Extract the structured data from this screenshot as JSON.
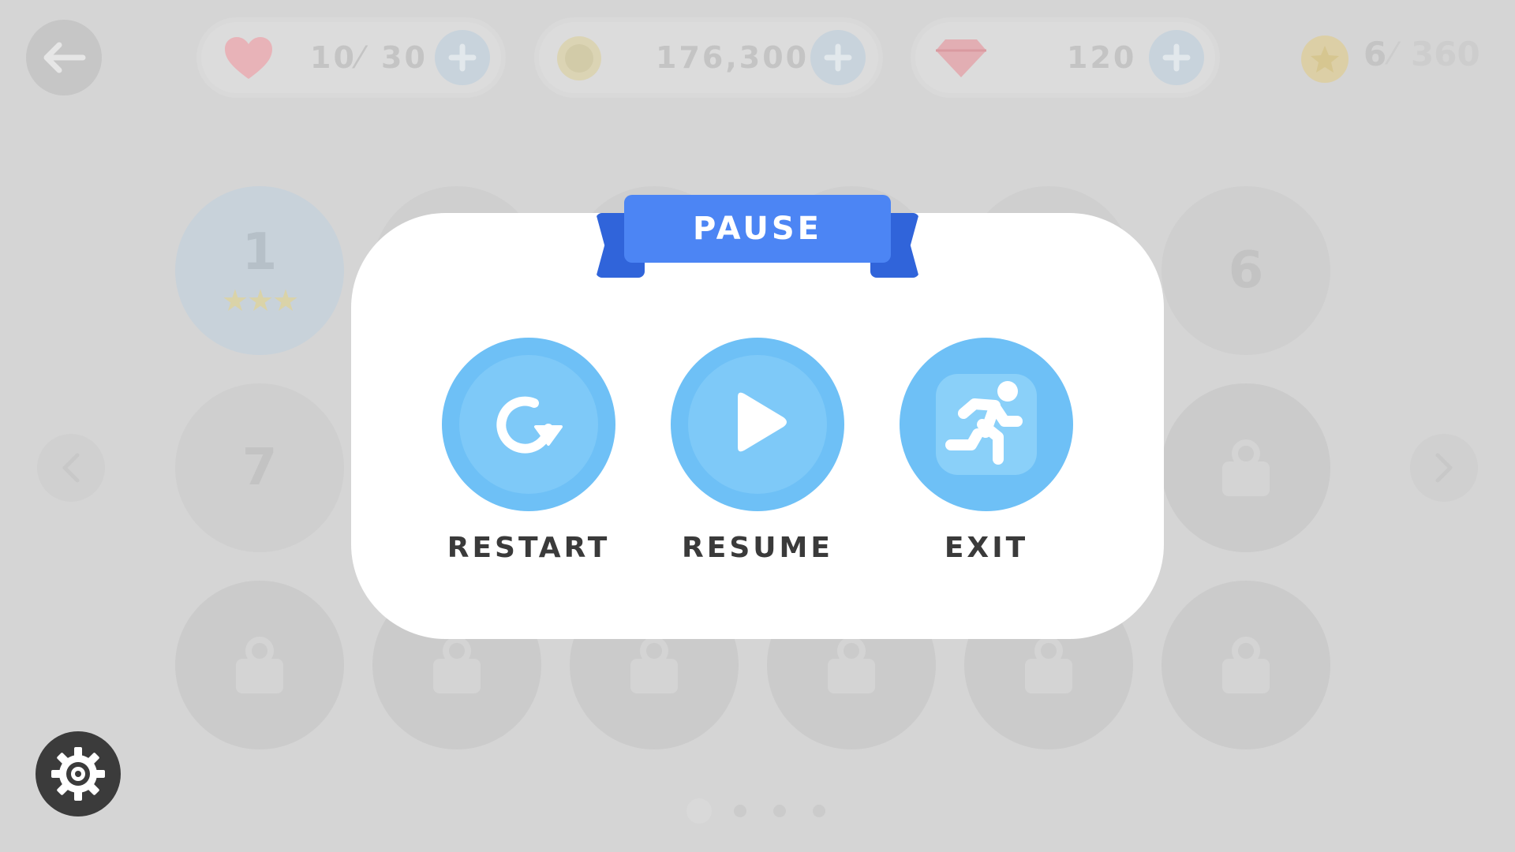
{
  "hud": {
    "lives_value": "10",
    "lives_max": "30",
    "coins": "176,300",
    "gems": "120",
    "stars_value": "6",
    "stars_max": "360"
  },
  "levels": [
    {
      "label": "1",
      "stars": 3,
      "status": "completed"
    },
    {
      "label": "6",
      "status": "unlocked"
    },
    {
      "label": "7",
      "status": "unlocked"
    }
  ],
  "dialog": {
    "title": "PAUSE",
    "actions": [
      {
        "label": "RESTART",
        "icon": "restart-icon"
      },
      {
        "label": "RESUME",
        "icon": "play-icon"
      },
      {
        "label": "EXIT",
        "icon": "running-man-icon"
      }
    ]
  },
  "colors": {
    "ribbon": "#4c85f4",
    "ribbon_tail": "#3064da",
    "action_circle": "#6ec0f6",
    "overlay_bg": "#d5d5d5"
  },
  "page_indicator": {
    "pages": 4,
    "current": 1
  }
}
